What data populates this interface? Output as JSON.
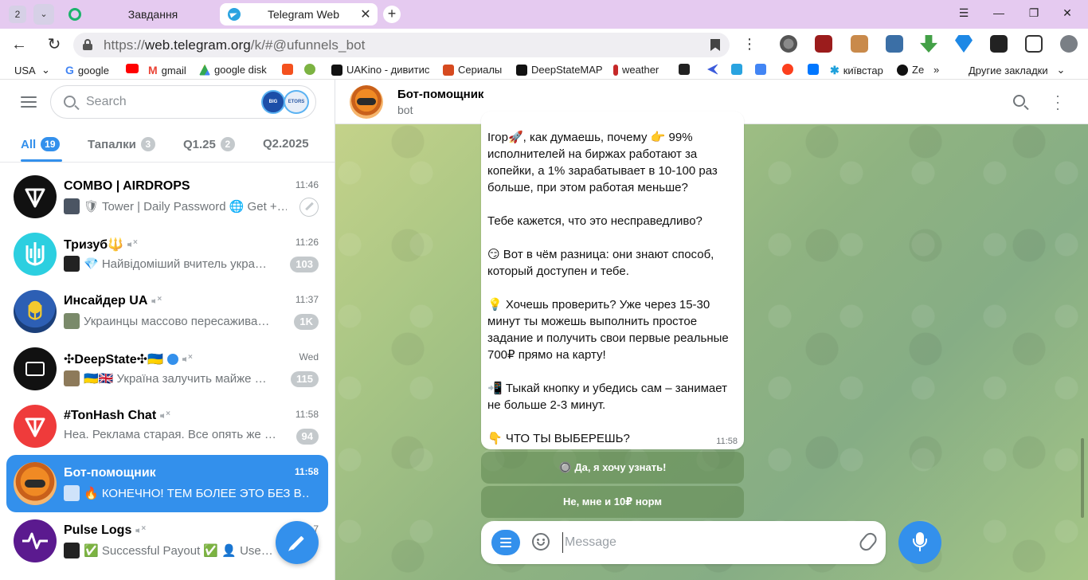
{
  "browser": {
    "tab_count": "2",
    "tabs": [
      {
        "title": "Завдання",
        "active": false
      },
      {
        "title": "Telegram Web",
        "active": true
      }
    ],
    "url": "https://web.telegram.org/k/#@ufunnels_bot",
    "url_prefix": "https://",
    "url_host": "web.telegram.org",
    "url_path": "/k/#@ufunnels_bot"
  },
  "bookmarks": [
    {
      "label": "USA",
      "icon": "chevron-down-icon"
    },
    {
      "label": "google",
      "icon": "google-icon",
      "color": "#4285f4"
    },
    {
      "label": "",
      "icon": "youtube-icon",
      "color": "#ff0000"
    },
    {
      "label": "gmail",
      "icon": "gmail-icon",
      "color": "#ea4335"
    },
    {
      "label": "google disk",
      "icon": "drive-icon",
      "color": "#34a853"
    },
    {
      "label": "",
      "icon": "f-icon",
      "color": "#f4511e"
    },
    {
      "label": "",
      "icon": "star-icon",
      "color": "#7cb342"
    },
    {
      "label": "UAKino - дивитис",
      "icon": "uakino-icon",
      "color": "#111111"
    },
    {
      "label": "Сериалы",
      "icon": "series-icon",
      "color": "#d64a1f"
    },
    {
      "label": "DeepStateMAP",
      "icon": "deepstate-icon",
      "color": "#111111"
    },
    {
      "label": "weather",
      "icon": "thermometer-icon",
      "color": "#c62828"
    },
    {
      "label": "",
      "icon": "bc-icon",
      "color": "#222222"
    },
    {
      "label": "",
      "icon": "kaspi-icon",
      "color": "#3b5bdb"
    },
    {
      "label": "",
      "icon": "p-icon",
      "color": "#29a3e0"
    },
    {
      "label": "",
      "icon": "translate-icon",
      "color": "#4285f4"
    },
    {
      "label": "",
      "icon": "yandex-icon",
      "color": "#fc3f1d"
    },
    {
      "label": "",
      "icon": "vk-icon",
      "color": "#0077ff"
    },
    {
      "label": "київстар",
      "icon": "kyivstar-icon",
      "color": "#1ea0db"
    },
    {
      "label": "Ze",
      "icon": "z-icon",
      "color": "#111111"
    },
    {
      "label": "»",
      "icon": "overflow-icon"
    },
    {
      "label": "Другие закладки",
      "icon": "chevron-down-icon"
    }
  ],
  "sidebar": {
    "search_placeholder": "Search",
    "search_badge_a": "BIG",
    "search_badge_b": "ETORS",
    "folders": [
      {
        "label": "All",
        "count": "19",
        "active": true
      },
      {
        "label": "Тапалки",
        "count": "3",
        "active": false
      },
      {
        "label": "Q1.25",
        "count": "2",
        "active": false
      },
      {
        "label": "Q2.2025",
        "count": "",
        "active": false
      }
    ],
    "chats": [
      {
        "name": "COMBO | AIRDROPS",
        "time": "11:46",
        "preview": "🛡 Tower | Daily Password 🌐 Get +…",
        "badge": "",
        "pinned": true,
        "muted": false,
        "active": false,
        "avatar_color": "#111111",
        "icon": "ton-icon"
      },
      {
        "name": "Тризуб🔱",
        "time": "11:26",
        "preview": "💎 Найвідоміший вчитель укра…",
        "badge": "103",
        "pinned": false,
        "muted": true,
        "active": false,
        "avatar_color": "#2ccfe0",
        "icon": "trident-icon"
      },
      {
        "name": "Инсайдер UA",
        "time": "11:37",
        "preview": "Украинцы массово пересажива…",
        "badge": "1K",
        "pinned": false,
        "muted": true,
        "active": false,
        "avatar_color": "#2d5fb4",
        "icon": "trident-icon"
      },
      {
        "name": "✣DeepState✣🇺🇦",
        "time": "Wed",
        "preview": "🇺🇦🇬🇧 Україна залучить майже …",
        "badge": "115",
        "pinned": false,
        "muted": true,
        "active": false,
        "avatar_color": "#111111",
        "icon": "deepstate-icon"
      },
      {
        "name": "#TonHash Chat",
        "time": "11:58",
        "preview": "Hea. Реклама старая. Все опять же …",
        "badge": "94",
        "pinned": false,
        "muted": true,
        "active": false,
        "avatar_color": "#ef3b3b",
        "icon": "ton-icon"
      },
      {
        "name": "Бот-помощник",
        "time": "11:58",
        "preview": "🔥 КОНЕЧНО! ТЕМ БОЛЕЕ ЭТО БЕЗ В…",
        "badge": "",
        "pinned": false,
        "muted": false,
        "active": true,
        "avatar_color": "#f08a24",
        "icon": "robot-icon"
      },
      {
        "name": "Pulse Logs",
        "time": "7",
        "preview": "✅ Successful Payout ✅ 👤 Use…",
        "badge": "",
        "pinned": false,
        "muted": true,
        "active": false,
        "avatar_color": "#5b1a8f",
        "icon": "pulse-icon"
      }
    ]
  },
  "chat": {
    "title": "Бот-помощник",
    "subtitle": "bot",
    "message": {
      "text": "Ігор🚀, как думаешь, почему 👉 99% исполнителей на биржах работают за копейки, а 1% зарабатывает в 10-100 раз больше, при этом работая меньше?\n\nТебе кажется, что это несправедливо?\n\n😏 Вот в чём разница: они знают способ, который доступен и тебе.\n\n💡 Хочешь проверить? Уже через 15-30 минут ты можешь выполнить простое задание и получить свои первые реальные 700₽ прямо на карту!\n\n📲 Тыкай кнопку и убедись сам – занимает не больше 2-3 минут.\n\n👇 ЧТО ТЫ ВЫБЕРЕШЬ?",
      "time": "11:58"
    },
    "buttons": [
      {
        "label": "🔘 Да, я хочу узнать!"
      },
      {
        "label": "Не, мне и 10₽ норм"
      }
    ],
    "input_placeholder": "Message"
  },
  "colors": {
    "accent": "#3390ec",
    "tab_strip": "#e5caf0"
  }
}
